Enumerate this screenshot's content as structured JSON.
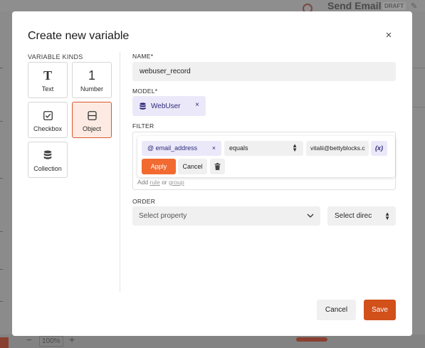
{
  "background": {
    "page_title": "Send Email",
    "status_badge": "DRAFT",
    "zoom_level": "100%",
    "zoom_minus": "−",
    "zoom_plus": "+"
  },
  "modal": {
    "title": "Create new variable",
    "close_icon": "×",
    "variable_kinds_label": "VARIABLE KINDS",
    "kinds": [
      {
        "label": "Text",
        "icon": "text-icon",
        "selected": false
      },
      {
        "label": "Number",
        "icon": "number-icon",
        "selected": false
      },
      {
        "label": "Checkbox",
        "icon": "checkbox-icon",
        "selected": false
      },
      {
        "label": "Object",
        "icon": "object-icon",
        "selected": true
      },
      {
        "label": "Collection",
        "icon": "collection-icon",
        "selected": false
      }
    ],
    "number_glyph": "1",
    "text_glyph": "T",
    "name": {
      "label": "NAME*",
      "value": "webuser_record"
    },
    "model": {
      "label": "MODEL*",
      "value": "WebUser",
      "remove_icon": "×"
    },
    "filter": {
      "label": "FILTER",
      "property": "@ email_address",
      "property_remove_icon": "×",
      "operator": "equals",
      "value": "vitalii@bettyblocks.c",
      "variable_button": "(x)",
      "apply_label": "Apply",
      "cancel_label": "Cancel",
      "add_text": "Add",
      "rule_link": "rule",
      "or_text": "or",
      "group_link": "group"
    },
    "order": {
      "label": "ORDER",
      "property_placeholder": "Select property",
      "direction_placeholder": "Select direc"
    },
    "footer": {
      "cancel_label": "Cancel",
      "save_label": "Save"
    }
  },
  "colors": {
    "accent": "#f26a30",
    "save": "#d2501a",
    "chip_bg": "#ebe9f9",
    "chip_text": "#2e2a7a",
    "selected_card_bg": "#fdebe3",
    "selected_card_border": "#d85a2a"
  }
}
